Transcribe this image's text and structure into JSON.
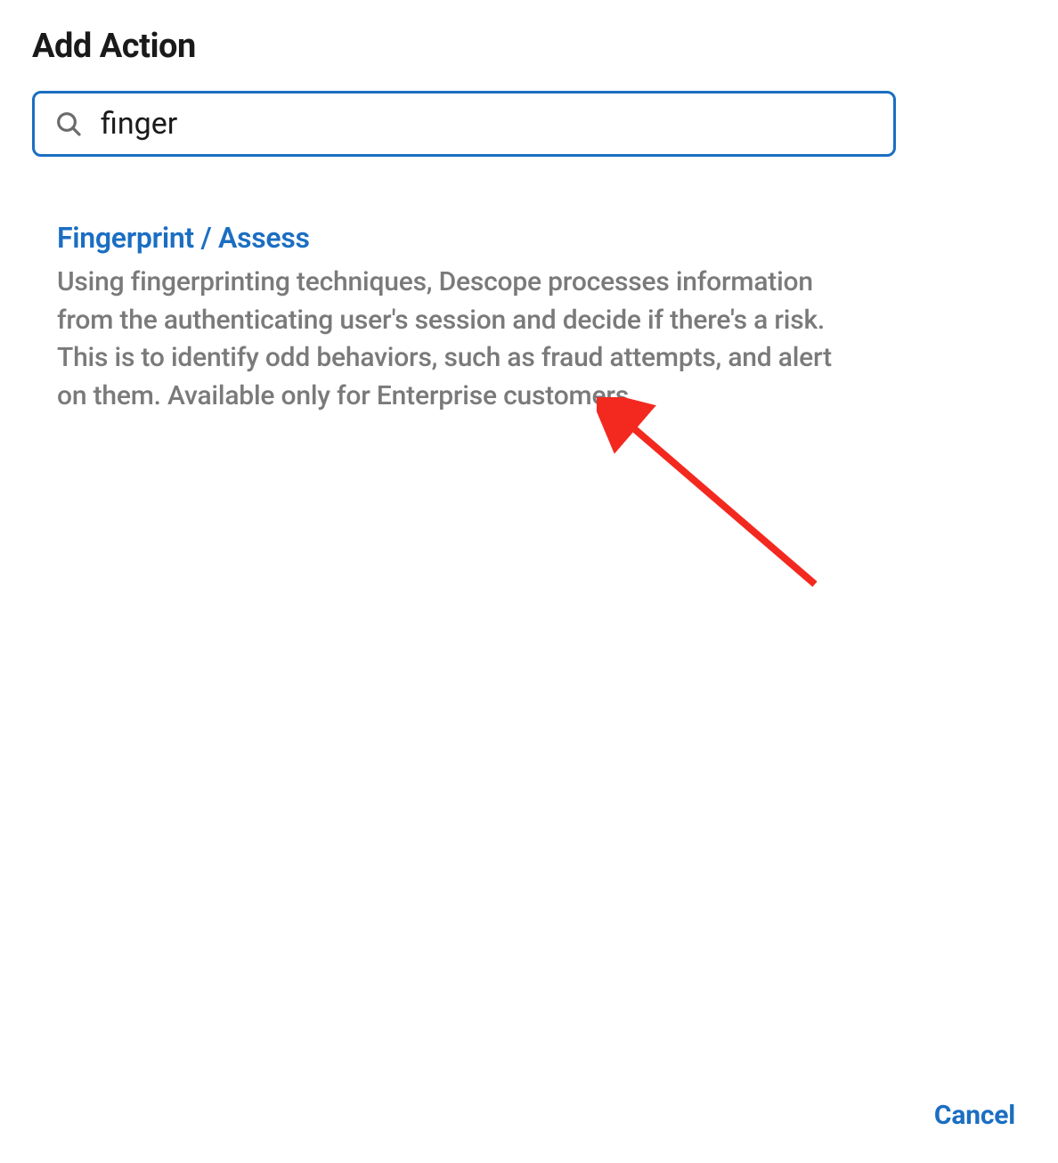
{
  "dialog": {
    "title": "Add Action"
  },
  "search": {
    "value": "finger",
    "placeholder": ""
  },
  "results": [
    {
      "title": "Fingerprint / Assess",
      "description": "Using fingerprinting techniques, Descope processes information from the authenticating user's session and decide if there's a risk. This is to identify odd behaviors, such as fraud attempts, and alert on them. Available only for Enterprise customers."
    }
  ],
  "footer": {
    "cancel_label": "Cancel"
  },
  "colors": {
    "accent": "#1b6ec2",
    "text_primary": "#1a1a1a",
    "text_muted": "#7a7a7a",
    "annotation": "#f3291f"
  }
}
